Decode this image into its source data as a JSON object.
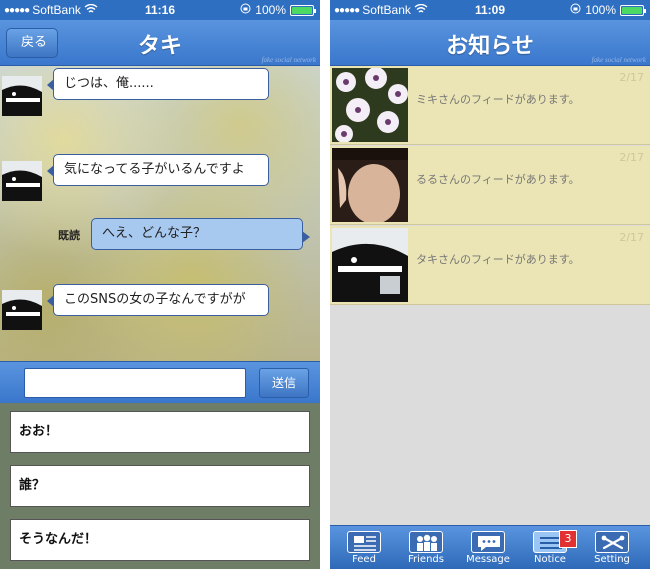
{
  "status_bar_left": {
    "carrier": "SoftBank",
    "time": "11:16",
    "battery": "100%"
  },
  "status_bar_right": {
    "carrier": "SoftBank",
    "time": "11:09",
    "battery": "100%"
  },
  "chat": {
    "back_label": "戻る",
    "title": "タキ",
    "watermark": "fake social network",
    "messages": [
      {
        "side": "in",
        "text": "じつは、俺......"
      },
      {
        "side": "in",
        "text": "気になってる子がいるんですよ"
      },
      {
        "side": "out",
        "text": "へえ、どんな子？",
        "read_label": "既読"
      },
      {
        "side": "in",
        "text": "このSNSの女の子なんですがが"
      }
    ],
    "input_value": "",
    "send_label": "送信",
    "quick_replies": [
      "おお！",
      "誰？",
      "そうなんだ！"
    ]
  },
  "notices": {
    "title": "お知らせ",
    "watermark": "fake social network",
    "items": [
      {
        "text": "ミキさんのフィードがあります。",
        "date": "2/17",
        "thumb": "flowers-photo"
      },
      {
        "text": "るるさんのフィードがあります。",
        "date": "2/17",
        "thumb": "person-photo"
      },
      {
        "text": "タキさんのフィードがあります。",
        "date": "2/17",
        "thumb": "anime-character-photo"
      }
    ]
  },
  "tabs": [
    {
      "label": "Feed",
      "icon": "feed-icon"
    },
    {
      "label": "Friends",
      "icon": "friends-icon"
    },
    {
      "label": "Message",
      "icon": "message-icon"
    },
    {
      "label": "Notice",
      "icon": "notice-icon",
      "badge": "3",
      "active": true
    },
    {
      "label": "Setting",
      "icon": "setting-icon"
    }
  ],
  "colors": {
    "nav_blue": "#3a77cc",
    "notice_bg": "#ebe4b5",
    "badge_red": "#e13131",
    "outgoing_bubble": "#a7c8ef"
  }
}
